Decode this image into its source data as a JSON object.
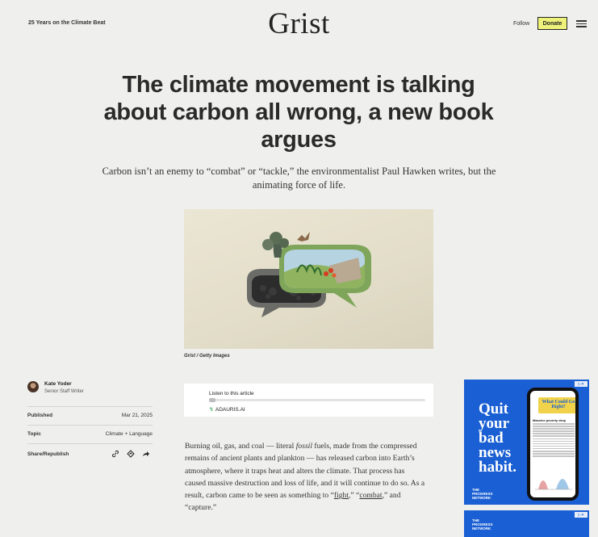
{
  "header": {
    "tagline": "25 Years on the Climate Beat",
    "logo": "Grist",
    "follow_label": "Follow",
    "donate_label": "Donate",
    "menu_icon": "hamburger-menu-icon"
  },
  "article": {
    "headline": "The climate movement is talking about carbon all wrong, a new book argues",
    "dek": "Carbon isn’t an enemy to “combat” or “tackle,” the environmentalist Paul Hawken writes, but the animating force of life.",
    "image_caption": "Grist / Getty Images"
  },
  "byline": {
    "author": "Kate Yoder",
    "role": "Senior Staff Writer",
    "published_label": "Published",
    "published_value": "Mar 21, 2025",
    "topic_label": "Topic",
    "topic_value": "Climate + Language",
    "share_label": "Share/Republish",
    "share_icons": [
      "link-icon",
      "republish-icon",
      "share-arrow-icon"
    ]
  },
  "listen": {
    "label": "Listen to this article",
    "brand": "ADAURIS.AI",
    "progress": 0.03
  },
  "body": {
    "p1_a": "Burning oil, gas, and coal — literal ",
    "p1_fossil": "fossil",
    "p1_b": " fuels, made from the compressed remains of ancient plants and plankton — has released carbon into Earth’s atmosphere, where it traps heat and alters the climate. That process has caused massive destruction and loss of life, and it will continue to do so. As a result, carbon came to be seen as something to “",
    "p1_fight": "fight",
    "p1_c": ",” “",
    "p1_combat": "combat",
    "p1_d": ",” and “capture.”"
  },
  "ads": {
    "ad1_text": "Quit your bad news habit.",
    "ad1_brand_line1": "THE",
    "ad1_brand_line2": "PROGRESS",
    "ad1_brand_line3": "NETWORK",
    "phone_headline": "What Could Go Right?",
    "phone_title": "Massive poverty drop",
    "ad2_brand_line1": "THE",
    "ad2_brand_line2": "PROGRESS",
    "ad2_brand_line3": "NETWORK",
    "ad_choice": "▷✕"
  },
  "colors": {
    "background": "#efefed",
    "donate_bg": "#eef27a",
    "ad_blue": "#1a5fd3",
    "ad_yellow": "#f1d34b"
  }
}
